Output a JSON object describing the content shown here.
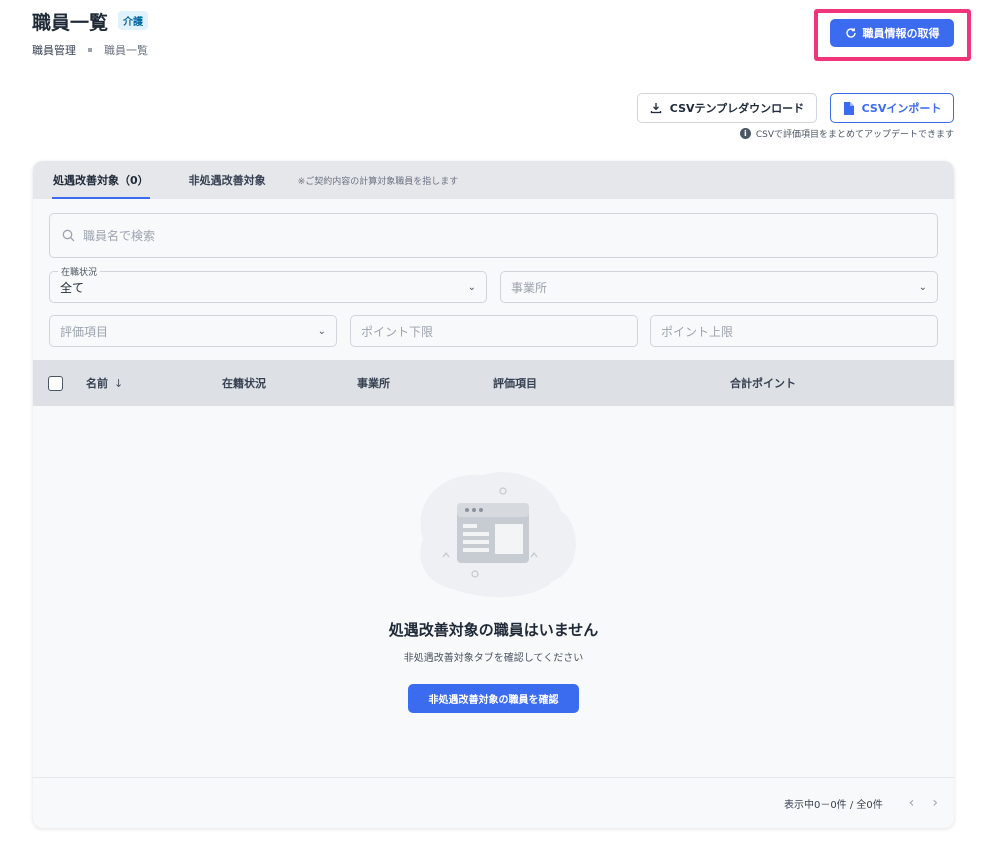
{
  "header": {
    "title": "職員一覧",
    "badge": "介護",
    "breadcrumb": [
      "職員管理",
      "職員一覧"
    ],
    "fetch_button": "職員情報の取得"
  },
  "csv": {
    "template_button": "CSVテンプレダウンロード",
    "import_button": "CSVインポート",
    "note": "CSVで評価項目をまとめてアップデートできます"
  },
  "tabs": {
    "active_label": "処遇改善対象",
    "active_count": "（0）",
    "other_label": "非処遇改善対象",
    "note": "※ご契約内容の計算対象職員を指します"
  },
  "search": {
    "placeholder": "職員名で検索"
  },
  "filters": {
    "employment_label": "在職状況",
    "employment_value": "全て",
    "office_placeholder": "事業所",
    "evaluation_placeholder": "評価項目",
    "point_min_placeholder": "ポイント下限",
    "point_max_placeholder": "ポイント上限"
  },
  "table": {
    "columns": [
      "名前",
      "在籍状況",
      "事業所",
      "評価項目",
      "合計ポイント"
    ]
  },
  "empty": {
    "title": "処遇改善対象の職員はいません",
    "subtitle": "非処遇改善対象タブを確認してください",
    "button": "非処遇改善対象の職員を確認"
  },
  "footer": {
    "count": "表示中0－0件 / 全0件"
  },
  "colors": {
    "primary": "#3b6cf0",
    "highlight": "#f0357a"
  }
}
